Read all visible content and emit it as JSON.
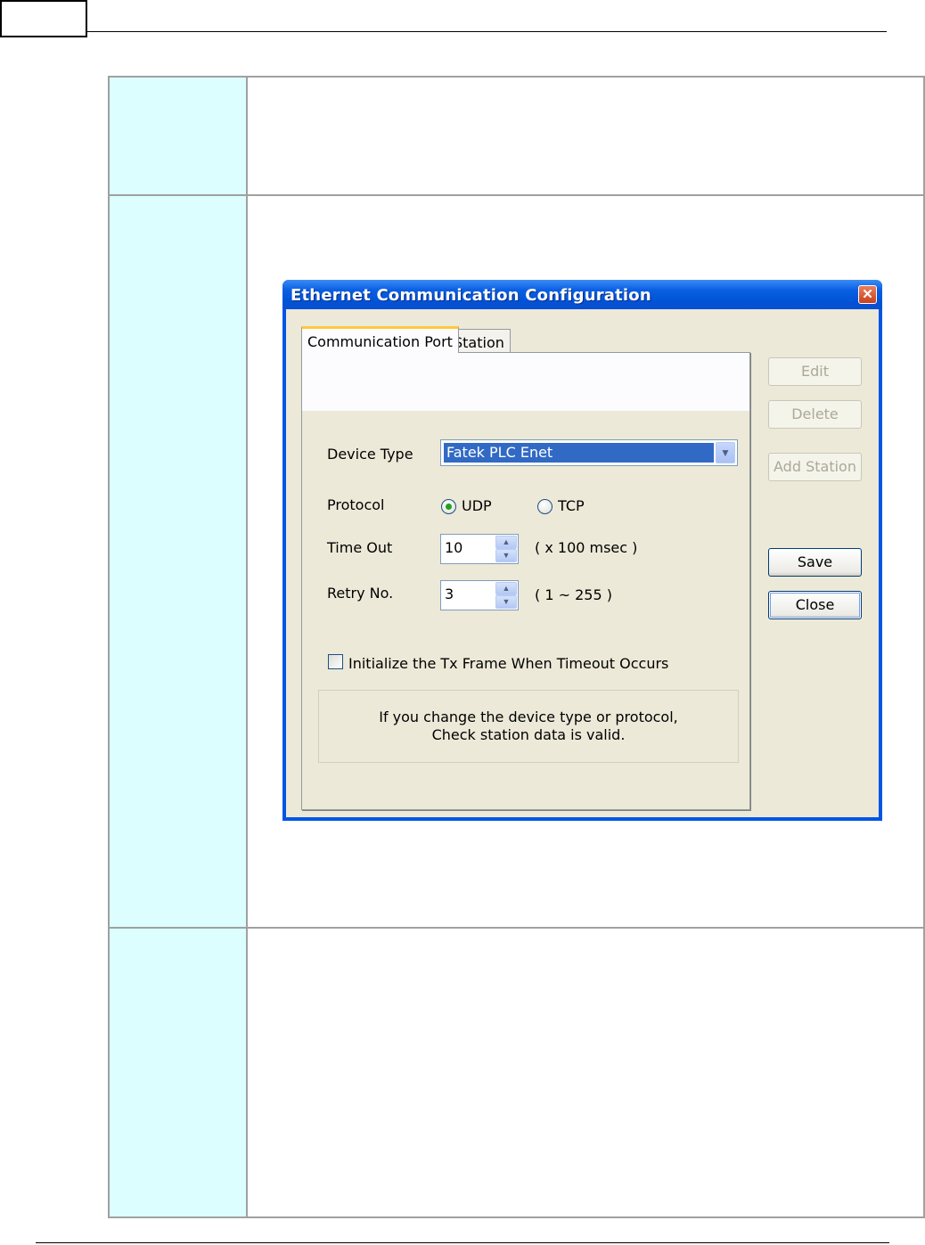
{
  "dialog": {
    "title": "Ethernet Communication Configuration",
    "close_glyph": "✕",
    "tabs": [
      {
        "label": "Communication Port",
        "active": true
      },
      {
        "label": "Station",
        "active": false
      }
    ],
    "device_type": {
      "label": "Device Type",
      "value": "Fatek PLC Enet"
    },
    "protocol": {
      "label": "Protocol",
      "options": [
        "UDP",
        "TCP"
      ],
      "selected": "UDP"
    },
    "time_out": {
      "label": "Time Out",
      "value": "10",
      "unit": "( x 100 msec )"
    },
    "retry": {
      "label": "Retry No.",
      "value": "3",
      "range": "( 1 ~ 255 )"
    },
    "init_tx": {
      "label": "Initialize the Tx Frame When Timeout  Occurs",
      "checked": false
    },
    "notice": {
      "line1": "If you change the device type or protocol,",
      "line2": "Check station data is valid."
    },
    "buttons": {
      "edit": "Edit",
      "delete": "Delete",
      "add_station": "Add Station",
      "save": "Save",
      "close": "Close"
    }
  },
  "colors": {
    "label_cell_bg": "#dcfefe",
    "title_bar": "#0a5fe2",
    "dialog_bg": "#ece9d8",
    "selection": "#316ac5"
  }
}
